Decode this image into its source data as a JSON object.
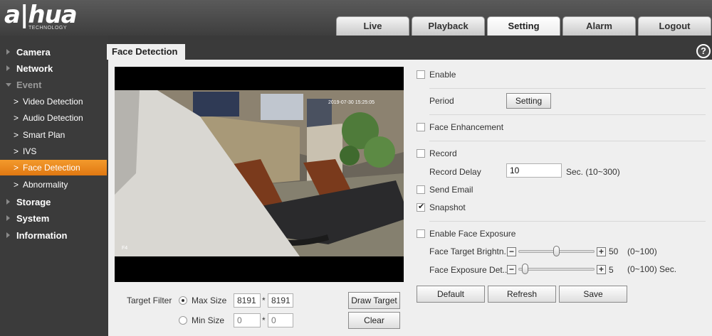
{
  "brand": {
    "logo": "a|hua",
    "sub": "TECHNOLOGY"
  },
  "top_tabs": [
    {
      "label": "Live"
    },
    {
      "label": "Playback"
    },
    {
      "label": "Setting",
      "active": true
    },
    {
      "label": "Alarm"
    },
    {
      "label": "Logout"
    }
  ],
  "sidebar": {
    "items": [
      {
        "label": "Camera"
      },
      {
        "label": "Network"
      },
      {
        "label": "Event"
      },
      {
        "label": "Storage"
      },
      {
        "label": "System"
      },
      {
        "label": "Information"
      }
    ],
    "event_sub": [
      {
        "label": "Video Detection"
      },
      {
        "label": "Audio Detection"
      },
      {
        "label": "Smart Plan"
      },
      {
        "label": "IVS"
      },
      {
        "label": "Face Detection",
        "active": true
      },
      {
        "label": "Abnormality"
      }
    ]
  },
  "page": {
    "title": "Face Detection",
    "help": "?"
  },
  "video": {
    "timestamp": "2019-07-30 15:25:05",
    "corner": "F4"
  },
  "target_filter": {
    "label": "Target Filter",
    "max": {
      "label": "Max Size",
      "w": "8191",
      "h": "8191",
      "selected": true
    },
    "min": {
      "label": "Min Size",
      "w": "0",
      "h": "0",
      "selected": false
    },
    "sep": "*",
    "draw_target": "Draw Target",
    "clear": "Clear"
  },
  "form": {
    "enable": {
      "label": "Enable",
      "checked": false
    },
    "period": {
      "label": "Period",
      "button": "Setting"
    },
    "face_enhancement": {
      "label": "Face Enhancement",
      "checked": false
    },
    "record": {
      "label": "Record",
      "checked": false
    },
    "record_delay": {
      "label": "Record Delay",
      "value": "10",
      "hint": "Sec. (10~300)"
    },
    "send_email": {
      "label": "Send Email",
      "checked": false
    },
    "snapshot": {
      "label": "Snapshot",
      "checked": true
    },
    "enable_face_exposure": {
      "label": "Enable Face Exposure",
      "checked": false
    },
    "target_brightness": {
      "label": "Face Target Brightn...",
      "value": "50",
      "level": 50,
      "range": "(0~100)"
    },
    "exposure_detect": {
      "label": "Face Exposure Det...",
      "value": "5",
      "level": 5,
      "range": "(0~100) Sec."
    }
  },
  "actions": {
    "default": "Default",
    "refresh": "Refresh",
    "save": "Save"
  }
}
